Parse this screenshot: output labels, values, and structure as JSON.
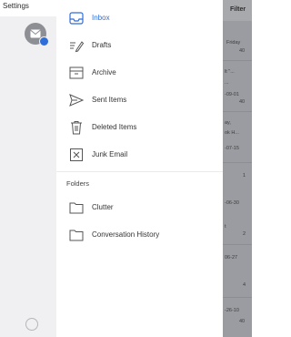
{
  "status_bar": {
    "text": "Settings"
  },
  "drawer": {
    "mail_items": [
      {
        "label": "Inbox",
        "icon": "inbox-icon",
        "selected": true
      },
      {
        "label": "Drafts",
        "icon": "drafts-icon",
        "selected": false
      },
      {
        "label": "Archive",
        "icon": "archive-icon",
        "selected": false
      },
      {
        "label": "Sent Items",
        "icon": "sent-icon",
        "selected": false
      },
      {
        "label": "Deleted Items",
        "icon": "trash-icon",
        "selected": false
      },
      {
        "label": "Junk Email",
        "icon": "junk-icon",
        "selected": false
      }
    ],
    "folders_header": "Folders",
    "folder_items": [
      {
        "label": "Clutter",
        "icon": "folder-icon"
      },
      {
        "label": "Conversation History",
        "icon": "folder-icon"
      }
    ]
  },
  "background": {
    "filter_label": "Filter",
    "snippets": [
      "Friday",
      "40",
      "lt \"...",
      "...",
      "-09-01",
      "40",
      "ay,",
      "ok H...",
      "-07-15",
      "1",
      "-06-30",
      "t",
      "2",
      "06-27",
      "4",
      "-26-10",
      "40"
    ]
  },
  "colors": {
    "accent": "#2f6ed8",
    "rail": "#f0f0f2",
    "overlay": "#9a9ca1"
  }
}
